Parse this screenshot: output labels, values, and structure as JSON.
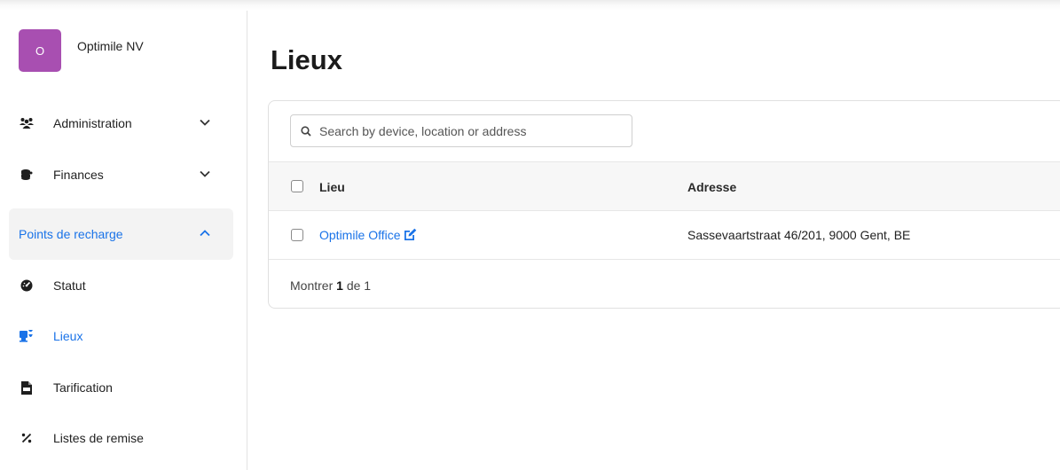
{
  "org": {
    "initial": "O",
    "name": "Optimile NV",
    "avatar_color": "#a84fb1"
  },
  "nav": {
    "administration": "Administration",
    "finances": "Finances",
    "charging_points": "Points de recharge",
    "statut": "Statut",
    "lieux": "Lieux",
    "tarification": "Tarification",
    "listes_remise": "Listes de remise"
  },
  "page": {
    "title": "Lieux"
  },
  "search": {
    "placeholder": "Search by device, location or address"
  },
  "table": {
    "columns": {
      "lieu": "Lieu",
      "adresse": "Adresse"
    },
    "rows": [
      {
        "lieu": "Optimile Office",
        "adresse": "Sassevaartstraat 46/201, 9000 Gent, BE"
      }
    ]
  },
  "footer": {
    "prefix": "Montrer",
    "count": "1",
    "of": "de",
    "total": "1"
  },
  "colors": {
    "accent": "#1a73e8",
    "active_section_bg": "#f3f3f3"
  }
}
